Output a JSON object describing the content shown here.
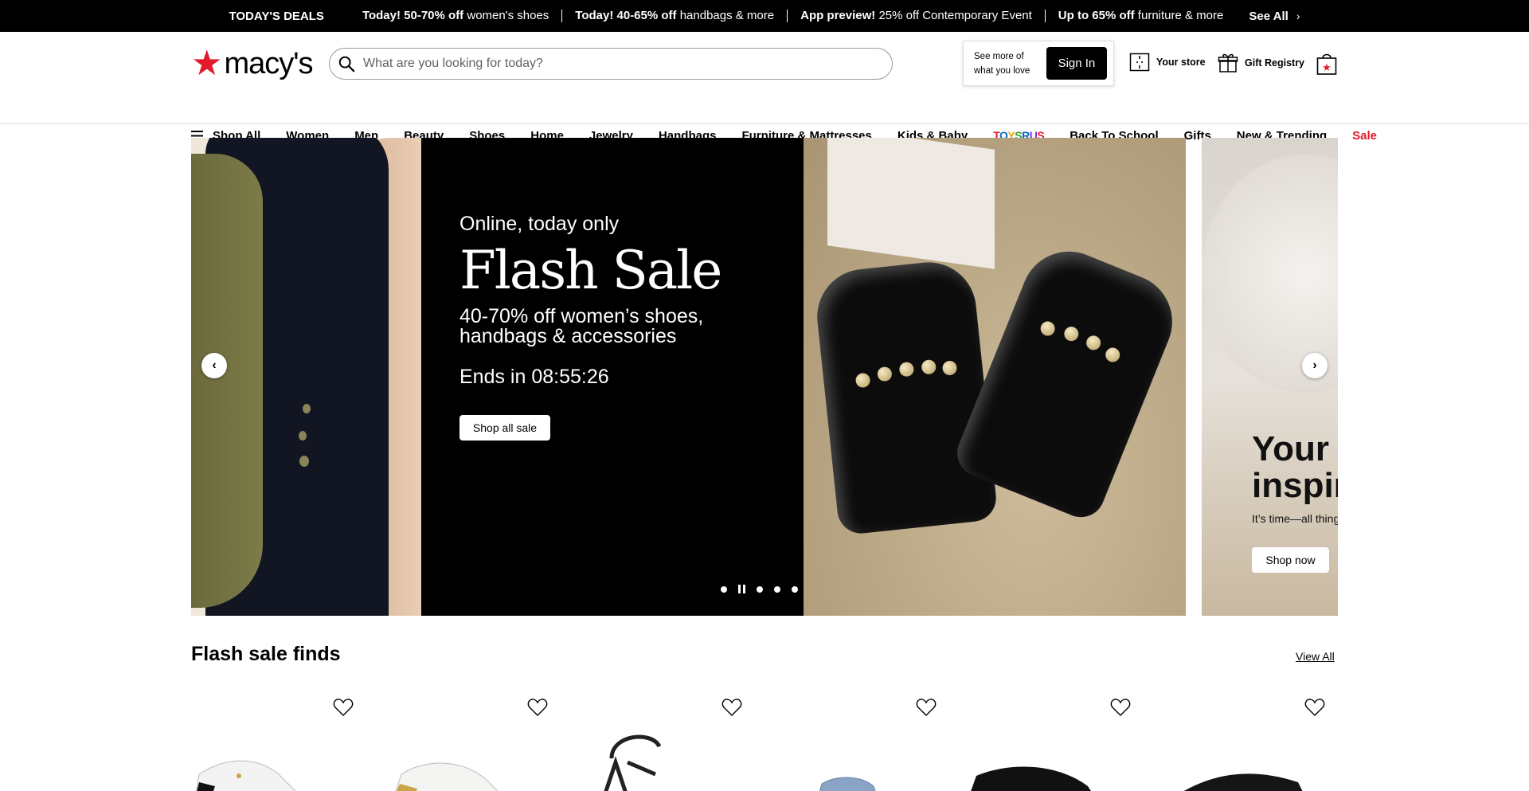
{
  "deals_bar": {
    "title": "TODAY'S DEALS",
    "deals": [
      {
        "bold": "Today! 50-70% off",
        "text": " women's shoes"
      },
      {
        "bold": "Today! 40-65% off",
        "text": " handbags & more"
      },
      {
        "bold": "App preview!",
        "text": " 25% off Contemporary Event"
      },
      {
        "bold": "Up to 65% off",
        "text": " furniture & more"
      }
    ],
    "see_all": "See All"
  },
  "header": {
    "logo_text": "macy's",
    "search_placeholder": "What are you looking for today?",
    "signin_message": "See more of what you love",
    "signin_label": "Sign In",
    "your_store": "Your store",
    "gift_registry": "Gift Registry"
  },
  "nav": {
    "shop_all": "Shop All",
    "items": [
      "Women",
      "Men",
      "Beauty",
      "Shoes",
      "Home",
      "Jewelry",
      "Handbags",
      "Furniture & Mattresses",
      "Kids & Baby"
    ],
    "toys": "Toys R Us",
    "items_after": [
      "Back To School",
      "Gifts",
      "New & Trending"
    ],
    "sale": "Sale"
  },
  "hero": {
    "eyebrow": "Online, today only",
    "headline": "Flash Sale",
    "subhead": "40-70% off women’s shoes, handbags & accessories",
    "ends_label": "Ends in",
    "countdown": "08:55:26",
    "cta": "Shop all sale",
    "next_slide_headline": "Your l inspir",
    "next_slide_line1": "Your l",
    "next_slide_line2": "inspir",
    "next_slide_sub": "It’s time—all thing",
    "next_slide_cta": "Shop now"
  },
  "flash_sale": {
    "title": "Flash sale finds",
    "view_all": "View All",
    "product_count": 6
  },
  "colors": {
    "brand_red": "#e21a2c",
    "deals_bar_bg": "#000000"
  }
}
